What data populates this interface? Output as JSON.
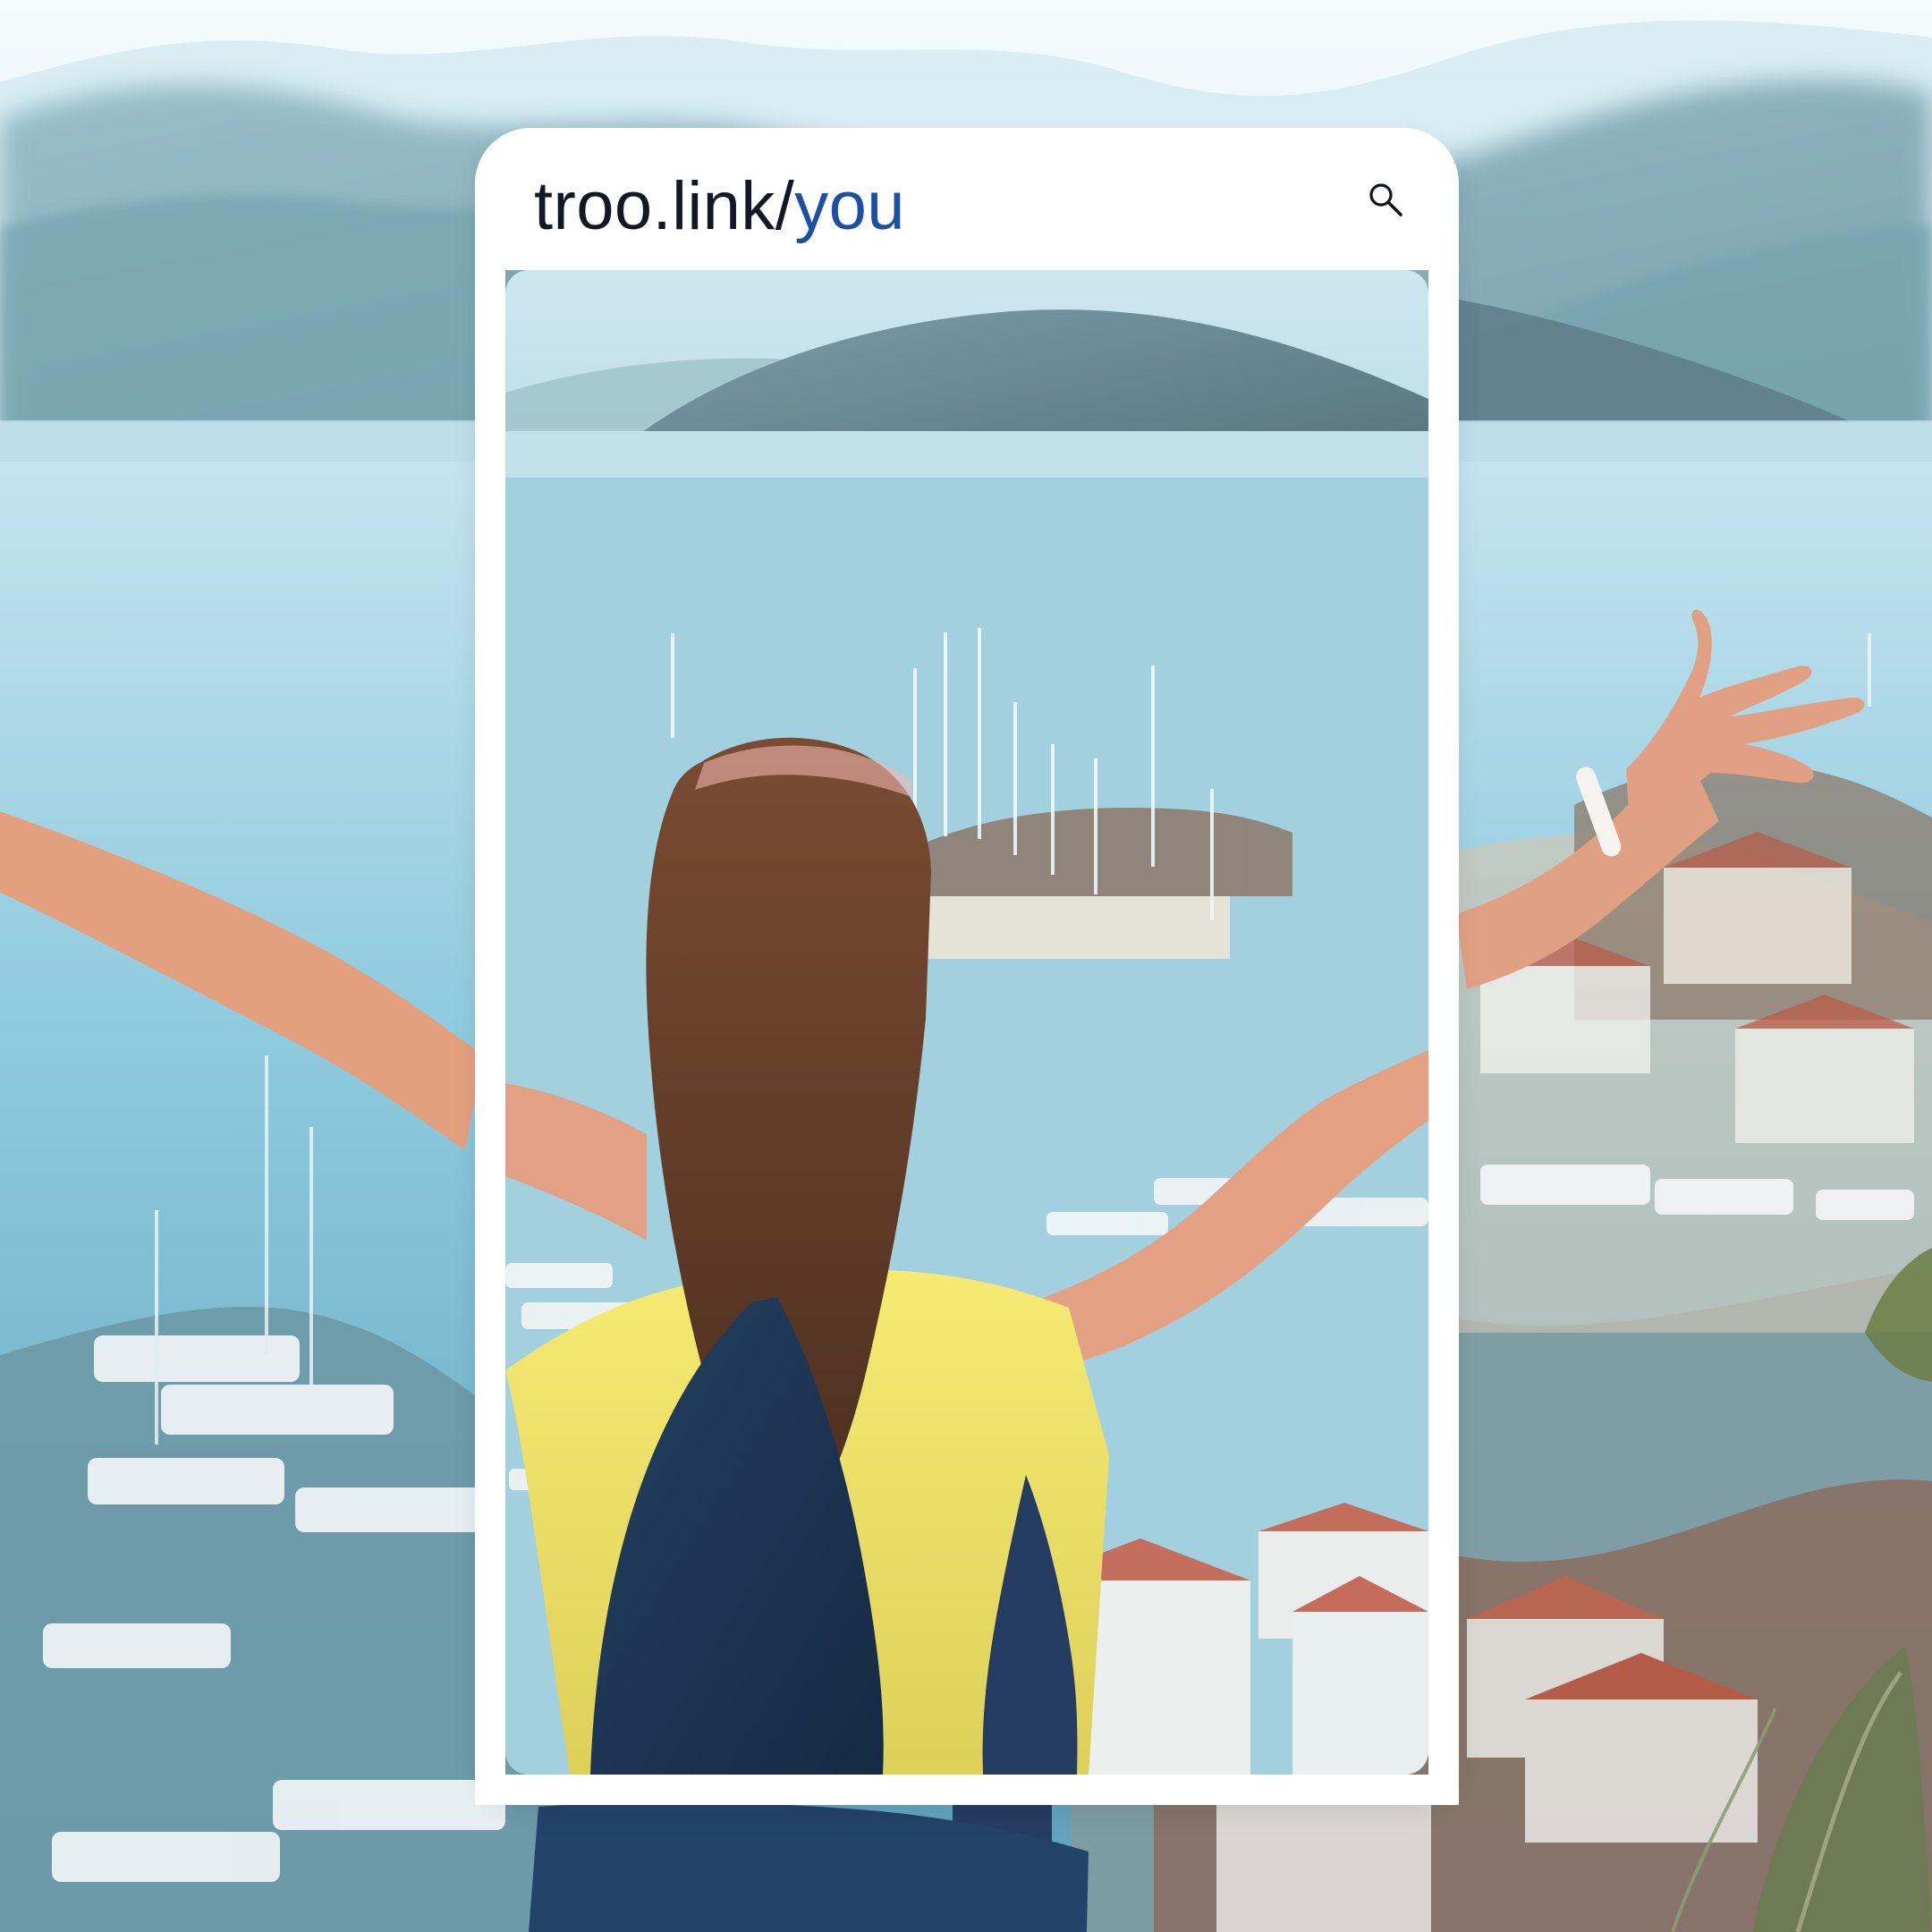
{
  "address_bar": {
    "url_host": "troo.link/",
    "url_path": "you"
  },
  "icons": {
    "search": "search-icon"
  },
  "colors": {
    "url_text": "#121826",
    "url_path": "#1d4fa2",
    "frame": "#ffffff"
  }
}
